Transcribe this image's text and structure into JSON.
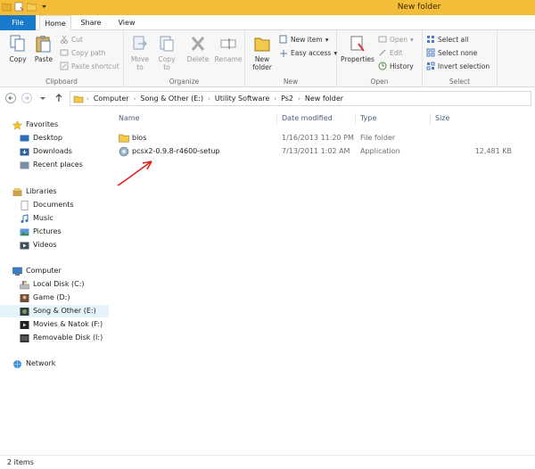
{
  "window": {
    "title": "New folder"
  },
  "ribbon_tabs": [
    "File",
    "Home",
    "Share",
    "View"
  ],
  "ribbon": {
    "clipboard": {
      "label": "Clipboard",
      "copy": "Copy",
      "paste": "Paste",
      "cut": "Cut",
      "copy_path": "Copy path",
      "paste_shortcut": "Paste shortcut"
    },
    "organize": {
      "label": "Organize",
      "move_to": "Move to",
      "copy_to": "Copy to",
      "delete": "Delete",
      "rename": "Rename"
    },
    "new": {
      "label": "New",
      "new_folder": "New folder",
      "new_item": "New item",
      "easy_access": "Easy access"
    },
    "open": {
      "label": "Open",
      "properties": "Properties",
      "open": "Open",
      "edit": "Edit",
      "history": "History"
    },
    "select": {
      "label": "Select",
      "select_all": "Select all",
      "select_none": "Select none",
      "invert_selection": "Invert selection"
    }
  },
  "breadcrumb": [
    "Computer",
    "Song & Other (E:)",
    "Utility Software",
    "Ps2",
    "New folder"
  ],
  "nav": {
    "favorites": "Favorites",
    "favorites_items": [
      "Desktop",
      "Downloads",
      "Recent places"
    ],
    "libraries": "Libraries",
    "libraries_items": [
      "Documents",
      "Music",
      "Pictures",
      "Videos"
    ],
    "computer": "Computer",
    "computer_items": [
      "Local Disk (C:)",
      "Game (D:)",
      "Song & Other (E:)",
      "Movies & Natok (F:)",
      "Removable Disk (I:)"
    ],
    "network": "Network"
  },
  "columns": [
    "Name",
    "Date modified",
    "Type",
    "Size"
  ],
  "files": [
    {
      "name": "bios",
      "date": "1/16/2013 11:20 PM",
      "type": "File folder",
      "size": ""
    },
    {
      "name": "pcsx2-0.9.8-r4600-setup",
      "date": "7/13/2011 1:02 AM",
      "type": "Application",
      "size": "12,481 KB"
    }
  ],
  "status": {
    "count": "2 items"
  },
  "colors": {
    "accent": "#1979ca",
    "titlebar": "#f3bd38",
    "annotation": "#e02020",
    "selection": "#e5f3fb"
  }
}
